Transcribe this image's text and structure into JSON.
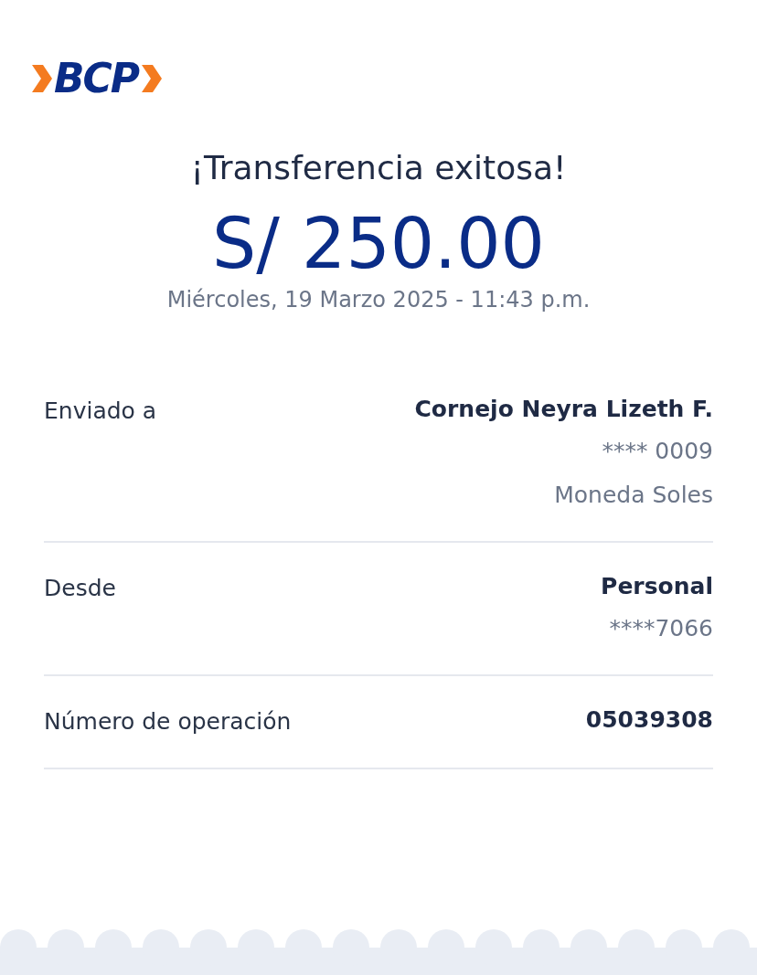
{
  "logo": "BCP",
  "title": "¡Transferencia exitosa!",
  "amount": "S/ 250.00",
  "datetime": "Miércoles, 19 Marzo 2025 - 11:43 p.m.",
  "details": [
    {
      "label": "Enviado a",
      "value": "Cornejo Neyra Lizeth F.",
      "lines": [
        "**** 0009",
        "Moneda Soles"
      ]
    },
    {
      "label": "Desde",
      "value": "Personal",
      "lines": [
        "****7066"
      ]
    },
    {
      "label": "Número de operación",
      "value": "05039308"
    }
  ]
}
